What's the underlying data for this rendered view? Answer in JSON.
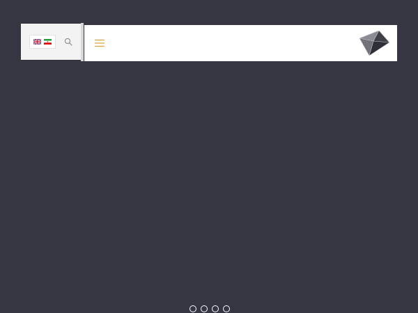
{
  "header": {
    "languages": [
      {
        "code": "en",
        "icon": "uk-flag-icon"
      },
      {
        "code": "fa",
        "icon": "iran-flag-icon"
      }
    ],
    "search_icon": "search-icon",
    "menu_icon": "hamburger-menu-icon",
    "logo_icon": "diamond-logo-icon"
  },
  "colors": {
    "background": "#363642",
    "header_white": "#ffffff",
    "header_gray": "#f3f3f3",
    "menu_accent": "#d9a441"
  },
  "slider": {
    "dot_count": 4,
    "active_index": null
  }
}
